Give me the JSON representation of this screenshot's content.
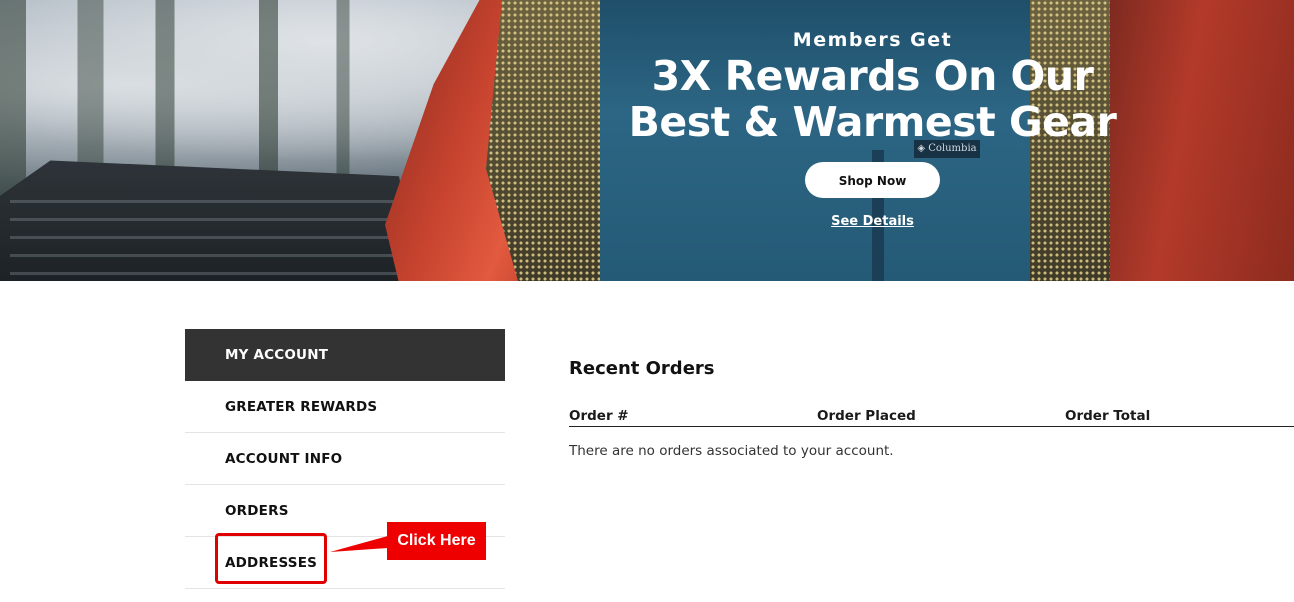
{
  "hero": {
    "kicker": "Members Get",
    "headline_line1": "3X Rewards On Our",
    "headline_line2": "Best & Warmest Gear",
    "shop_button": "Shop Now",
    "see_details": "See Details",
    "chest_logo": "◈ Columbia"
  },
  "sidebar": {
    "items": [
      {
        "label": "MY ACCOUNT",
        "active": true
      },
      {
        "label": "GREATER REWARDS",
        "active": false
      },
      {
        "label": "ACCOUNT INFO",
        "active": false
      },
      {
        "label": "ORDERS",
        "active": false
      },
      {
        "label": "ADDRESSES",
        "active": false
      }
    ]
  },
  "main": {
    "title": "Recent Orders",
    "columns": [
      "Order #",
      "Order Placed",
      "Order Total"
    ],
    "empty_message": "There are no orders associated to your account."
  },
  "annotation": {
    "callout": "Click Here",
    "color": "#ee0000"
  },
  "colors": {
    "active_nav_bg": "#333333",
    "page_bg": "#ffffff"
  }
}
